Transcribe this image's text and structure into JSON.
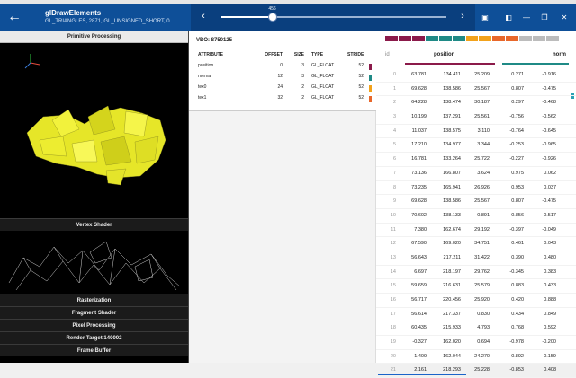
{
  "titlebar": {
    "title": "glDrawElements",
    "subtitle": "GL_TRIANGLES, 2871, GL_UNSIGNED_SHORT, 0",
    "back_icon": "arrow-left-icon",
    "scrubber_value": "456",
    "scrubber_fraction": 0.226,
    "colors": {
      "bar": "#0e4f98",
      "scrubber_bg": "#0a3f7e"
    }
  },
  "pipeline": {
    "header": "Primitive Processing",
    "stages": [
      "Vertex Shader",
      "Rasterization",
      "Fragment Shader",
      "Pixel Processing",
      "Render Target 140002",
      "Frame Buffer"
    ]
  },
  "vbo": {
    "title": "VBO: 8750125",
    "headers": {
      "name": "ATTRIBUTE",
      "offset": "OFFSET",
      "size": "SIZE",
      "type": "TYPE",
      "stride": "STRIDE"
    },
    "attributes": [
      {
        "name": "position",
        "offset": "0",
        "size": "3",
        "type": "GL_FLOAT",
        "stride": "52",
        "color": "#8b1a4a"
      },
      {
        "name": "normal",
        "offset": "12",
        "size": "3",
        "type": "GL_FLOAT",
        "stride": "52",
        "color": "#1f8a86"
      },
      {
        "name": "tex0",
        "offset": "24",
        "size": "2",
        "type": "GL_FLOAT",
        "stride": "52",
        "color": "#f2a21b"
      },
      {
        "name": "tex1",
        "offset": "32",
        "size": "2",
        "type": "GL_FLOAT",
        "stride": "52",
        "color": "#e8672a"
      }
    ]
  },
  "data_table": {
    "headers": {
      "id": "id",
      "position": "position",
      "normal": "norm"
    },
    "rows": [
      {
        "id": "0",
        "x": "63.781",
        "y": "134.411",
        "z": "25.209",
        "nx": "0.271",
        "ny": "-0.916"
      },
      {
        "id": "1",
        "x": "69.628",
        "y": "138.586",
        "z": "25.567",
        "nx": "0.807",
        "ny": "-0.475"
      },
      {
        "id": "2",
        "x": "64.228",
        "y": "138.474",
        "z": "30.187",
        "nx": "0.297",
        "ny": "-0.468"
      },
      {
        "id": "3",
        "x": "10.199",
        "y": "137.291",
        "z": "25.561",
        "nx": "-0.756",
        "ny": "-0.562"
      },
      {
        "id": "4",
        "x": "11.037",
        "y": "138.575",
        "z": "3.110",
        "nx": "-0.764",
        "ny": "-0.645"
      },
      {
        "id": "5",
        "x": "17.210",
        "y": "134.977",
        "z": "3.344",
        "nx": "-0.253",
        "ny": "-0.965"
      },
      {
        "id": "6",
        "x": "16.781",
        "y": "133.264",
        "z": "25.722",
        "nx": "-0.227",
        "ny": "-0.926"
      },
      {
        "id": "7",
        "x": "73.136",
        "y": "166.807",
        "z": "3.624",
        "nx": "0.975",
        "ny": "0.062"
      },
      {
        "id": "8",
        "x": "73.235",
        "y": "165.941",
        "z": "26.926",
        "nx": "0.953",
        "ny": "0.037"
      },
      {
        "id": "9",
        "x": "69.628",
        "y": "138.586",
        "z": "25.567",
        "nx": "0.807",
        "ny": "-0.475"
      },
      {
        "id": "10",
        "x": "70.602",
        "y": "138.133",
        "z": "0.891",
        "nx": "0.856",
        "ny": "-0.517"
      },
      {
        "id": "11",
        "x": "7.380",
        "y": "162.674",
        "z": "29.192",
        "nx": "-0.397",
        "ny": "-0.049"
      },
      {
        "id": "12",
        "x": "67.590",
        "y": "169.020",
        "z": "34.751",
        "nx": "0.461",
        "ny": "0.043"
      },
      {
        "id": "13",
        "x": "56.643",
        "y": "217.211",
        "z": "31.422",
        "nx": "0.390",
        "ny": "0.480"
      },
      {
        "id": "14",
        "x": "6.697",
        "y": "218.197",
        "z": "29.762",
        "nx": "-0.345",
        "ny": "0.383"
      },
      {
        "id": "15",
        "x": "59.659",
        "y": "216.631",
        "z": "25.579",
        "nx": "0.883",
        "ny": "0.433"
      },
      {
        "id": "16",
        "x": "56.717",
        "y": "220.456",
        "z": "25.920",
        "nx": "0.420",
        "ny": "0.888"
      },
      {
        "id": "17",
        "x": "56.614",
        "y": "217.337",
        "z": "0.830",
        "nx": "0.434",
        "ny": "0.849"
      },
      {
        "id": "18",
        "x": "60.435",
        "y": "215.933",
        "z": "4.793",
        "nx": "0.768",
        "ny": "0.592"
      },
      {
        "id": "19",
        "x": "-0.327",
        "y": "162.020",
        "z": "0.694",
        "nx": "-0.978",
        "ny": "-0.200"
      },
      {
        "id": "20",
        "x": "1.409",
        "y": "162.044",
        "z": "24.270",
        "nx": "-0.892",
        "ny": "-0.159"
      },
      {
        "id": "21",
        "x": "2.161",
        "y": "218.293",
        "z": "25.228",
        "nx": "-0.853",
        "ny": "0.408"
      }
    ],
    "colors": {
      "position": "#8b1a4a",
      "normal": "#1f8a86",
      "selection": "#1a63c9"
    }
  }
}
